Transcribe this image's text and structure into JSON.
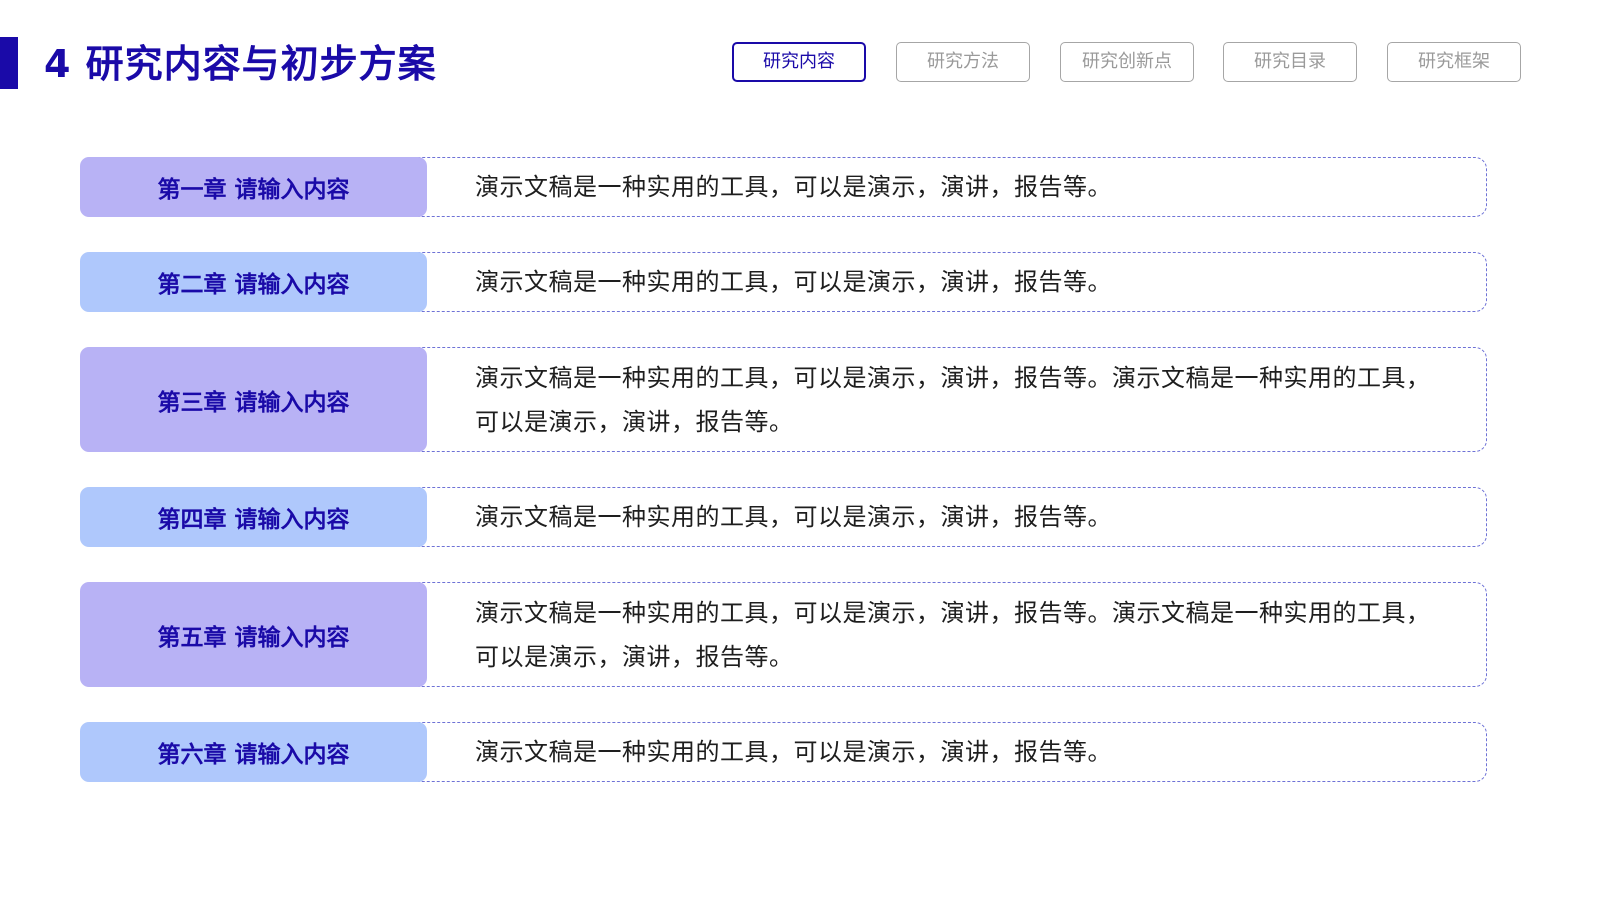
{
  "header": {
    "title": "4 研究内容与初步方案"
  },
  "tabs": [
    {
      "label": "研究内容",
      "active": true
    },
    {
      "label": "研究方法",
      "active": false
    },
    {
      "label": "研究创新点",
      "active": false
    },
    {
      "label": "研究目录",
      "active": false
    },
    {
      "label": "研究框架",
      "active": false
    }
  ],
  "rows": [
    {
      "chapter": "第一章  请输入内容",
      "text": "演示文稿是一种实用的工具，可以是演示，演讲，报告等。"
    },
    {
      "chapter": "第二章  请输入内容",
      "text": "演示文稿是一种实用的工具，可以是演示，演讲，报告等。"
    },
    {
      "chapter": "第三章  请输入内容",
      "text": "演示文稿是一种实用的工具，可以是演示，演讲，报告等。演示文稿是一种实用的工具，可以是演示，演讲，报告等。"
    },
    {
      "chapter": "第四章  请输入内容",
      "text": "演示文稿是一种实用的工具，可以是演示，演讲，报告等。"
    },
    {
      "chapter": "第五章  请输入内容",
      "text": "演示文稿是一种实用的工具，可以是演示，演讲，报告等。演示文稿是一种实用的工具，可以是演示，演讲，报告等。"
    },
    {
      "chapter": "第六章  请输入内容",
      "text": "演示文稿是一种实用的工具，可以是演示，演讲，报告等。"
    }
  ],
  "colors": {
    "accent": "#1a0aa8",
    "chapter_purple": "#b8b2f5",
    "chapter_blue": "#afc8fc",
    "dashed_border": "#6e72d6",
    "tab_inactive": "#9a9a9a"
  }
}
